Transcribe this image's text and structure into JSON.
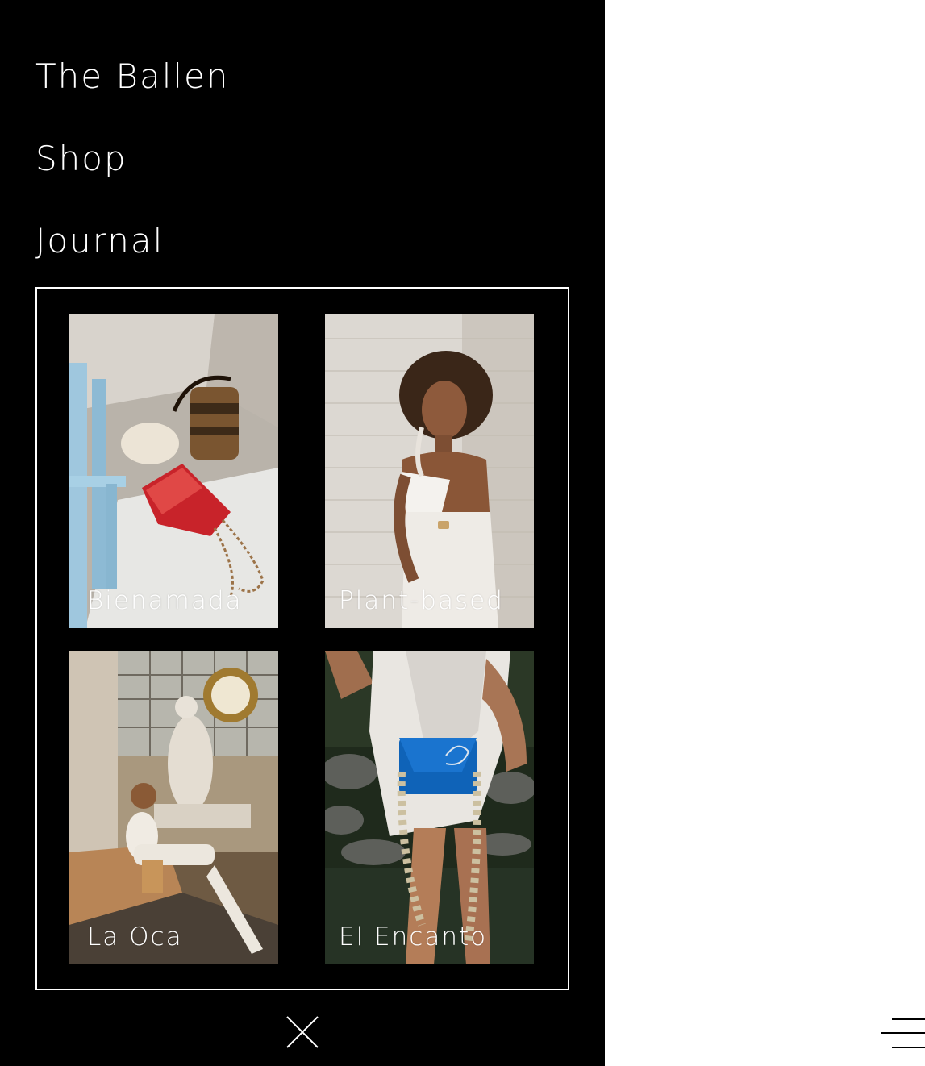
{
  "nav": {
    "items": [
      {
        "label": "The Ballen"
      },
      {
        "label": "Shop"
      },
      {
        "label": "Journal"
      }
    ]
  },
  "collections": [
    {
      "label": "Bienamada",
      "image": "red-bag-on-stone-floor-photo"
    },
    {
      "label": "Plant-based",
      "image": "model-white-bag-brick-wall-photo"
    },
    {
      "label": "La Oca",
      "image": "model-museum-statue-photo"
    },
    {
      "label": "El Encanto",
      "image": "model-blue-clutch-river-photo"
    }
  ],
  "controls": {
    "close_icon": "close-icon",
    "menu_icon": "hamburger-menu-icon"
  },
  "colors": {
    "panel_bg": "#000000",
    "page_bg": "#ffffff",
    "text": "#ffffff"
  }
}
